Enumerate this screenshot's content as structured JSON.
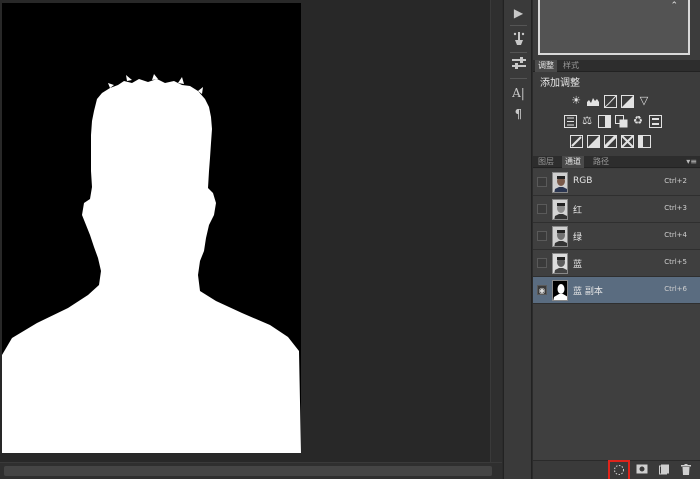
{
  "adjust_panel": {
    "tabs": [
      "调整",
      "样式"
    ],
    "title": "添加调整",
    "icons_row1": [
      "brightness-contrast-icon",
      "levels-icon",
      "curves-icon",
      "exposure-icon",
      "gradient-map-triangle-icon"
    ],
    "icons_row2": [
      "vibrance-icon",
      "hue-saturation-icon",
      "color-balance-icon",
      "black-white-icon",
      "photo-filter-icon",
      "channel-mixer-icon",
      "color-lookup-icon"
    ],
    "icons_row3": [
      "invert-icon",
      "posterize-icon",
      "threshold-icon",
      "selective-color-icon",
      "gradient-fill-icon"
    ]
  },
  "channels_panel": {
    "tabs": [
      "图层",
      "通道",
      "路径"
    ],
    "active_tab": "通道",
    "rows": [
      {
        "name": "RGB",
        "shortcut": "Ctrl+2",
        "visible": false,
        "selected": false
      },
      {
        "name": "红",
        "shortcut": "Ctrl+3",
        "visible": false,
        "selected": false
      },
      {
        "name": "绿",
        "shortcut": "Ctrl+4",
        "visible": false,
        "selected": false
      },
      {
        "name": "蓝",
        "shortcut": "Ctrl+5",
        "visible": false,
        "selected": false
      },
      {
        "name": "蓝 副本",
        "shortcut": "Ctrl+6",
        "visible": true,
        "selected": true
      }
    ]
  },
  "navigator": {
    "mark": "⌃"
  },
  "tools": [
    "play-icon",
    "brush-presets-icon",
    "tool-presets-icon",
    "character-icon",
    "paragraph-icon"
  ],
  "bottom_buttons": [
    "load-selection-icon",
    "save-selection-mask-icon",
    "new-channel-icon",
    "delete-channel-icon"
  ],
  "colors": {
    "selection_highlight": "#e0241b",
    "selected_row": "#5a6c80"
  }
}
